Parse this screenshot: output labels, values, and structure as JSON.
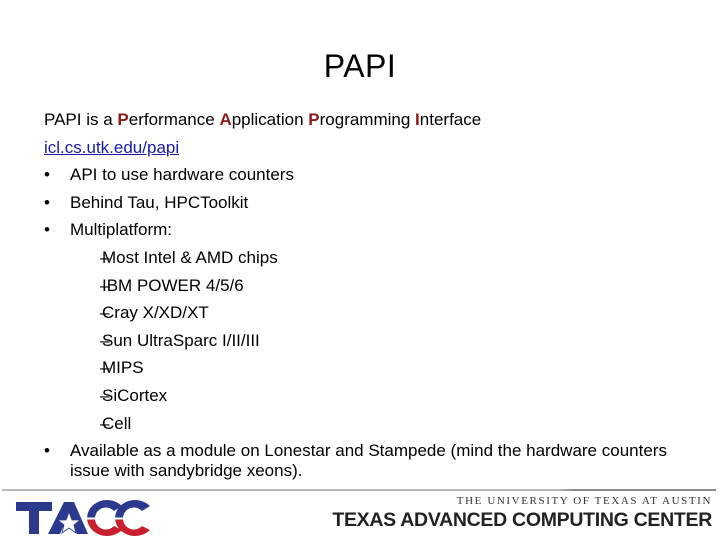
{
  "slide": {
    "title": "PAPI",
    "intro": {
      "prefix": "PAPI is a ",
      "words": [
        {
          "accent": "P",
          "rest": "erformance "
        },
        {
          "accent": "A",
          "rest": "pplication "
        },
        {
          "accent": "P",
          "rest": "rogramming "
        },
        {
          "accent": "I",
          "rest": "nterface"
        }
      ]
    },
    "link": "icl.cs.utk.edu/papi",
    "bullets": [
      "API to use hardware counters",
      "Behind Tau, HPCToolkit",
      "Multiplatform:"
    ],
    "platforms": [
      "Most Intel & AMD chips",
      "IBM POWER 4/5/6",
      "Cray X/XD/XT",
      "Sun UltraSparc I/II/III",
      "MIPS",
      "SiCortex",
      "Cell"
    ],
    "last_bullet": "Available as a module on Lonestar and Stampede (mind the hardware counters issue with sandybridge xeons).",
    "bullet_glyph": "•",
    "dash_glyph": "–",
    "accent_color": "#8b1a1a",
    "link_color": "#1a1aa6"
  },
  "footer": {
    "logo_text": "TACC",
    "university": "THE UNIVERSITY OF TEXAS AT AUSTIN",
    "center_name": "TEXAS ADVANCED COMPUTING CENTER",
    "logo_colors": {
      "blue": "#2b3a8c",
      "red": "#c8202f",
      "white": "#ffffff"
    }
  }
}
